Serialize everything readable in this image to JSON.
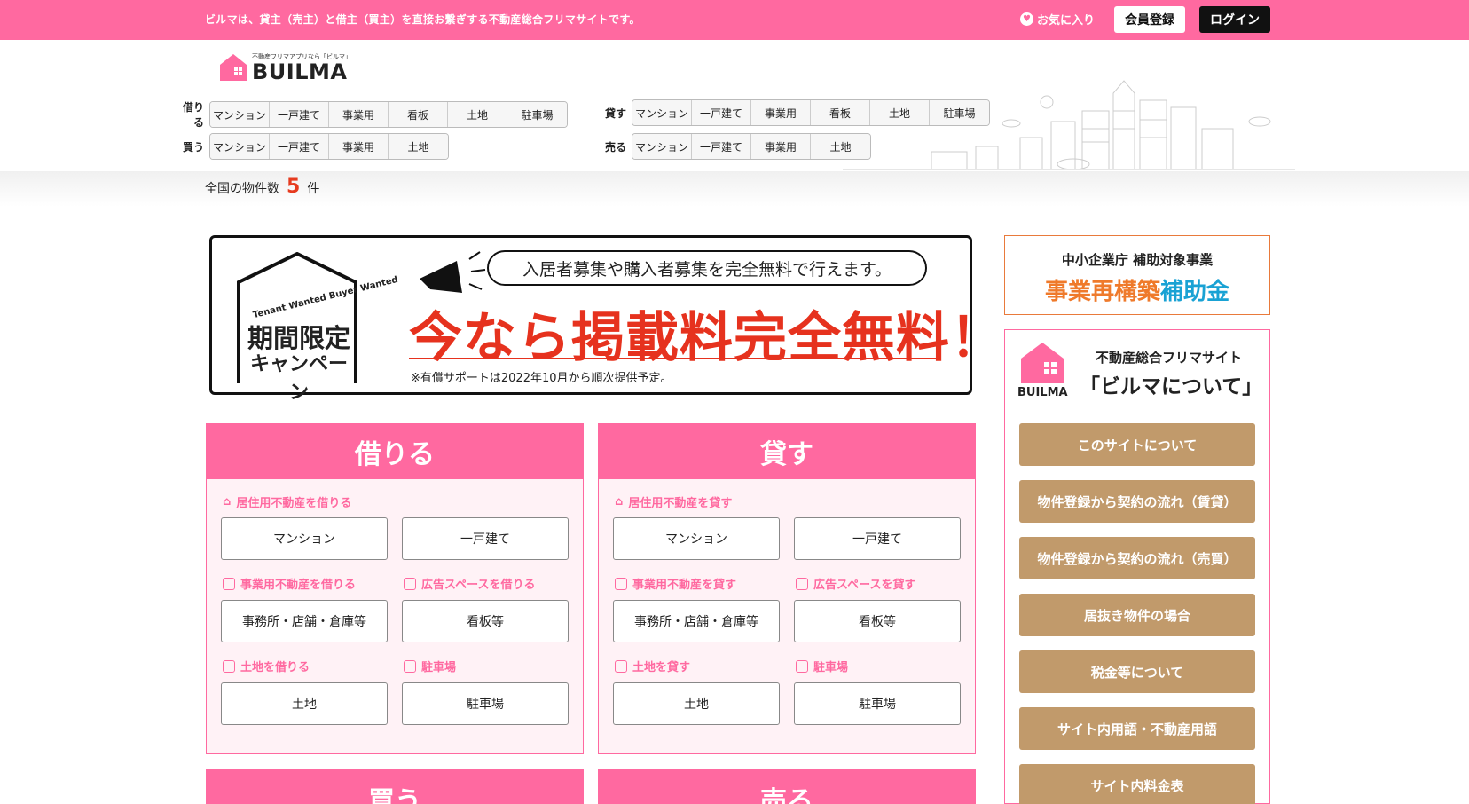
{
  "topbar": {
    "tagline": "ビルマは、貸主（売主）と借主（買主）を直接お繋ぎする不動産総合フリマサイトです。",
    "favorites": "お気に入り",
    "register": "会員登録",
    "login": "ログイン"
  },
  "logo": {
    "small": "不動産フリマアプリなら「ビルマ」",
    "big": "BUILMA"
  },
  "nav": {
    "rent": {
      "label": "借りる",
      "items": [
        "マンション",
        "一戸建て",
        "事業用",
        "看板",
        "土地",
        "駐車場"
      ]
    },
    "buy": {
      "label": "買う",
      "items": [
        "マンション",
        "一戸建て",
        "事業用",
        "土地"
      ]
    },
    "lend": {
      "label": "貸す",
      "items": [
        "マンション",
        "一戸建て",
        "事業用",
        "看板",
        "土地",
        "駐車場"
      ]
    },
    "sell": {
      "label": "売る",
      "items": [
        "マンション",
        "一戸建て",
        "事業用",
        "土地"
      ]
    }
  },
  "count": {
    "prefix": "全国の物件数",
    "value": "5",
    "suffix": "件"
  },
  "banner": {
    "tag_en": "Tenant Wanted Buyer Wanted",
    "badge_line1": "期間限定",
    "badge_line2": "キャンペーン",
    "bubble": "入居者募集や購入者募集を完全無料で行えます。",
    "headline": "今なら掲載料完全無料！",
    "note": "※有償サポートは2022年10月から順次提供予定。"
  },
  "cards": [
    {
      "title": "借りる",
      "sec1": "居住用不動産を借りる",
      "b1": "マンション",
      "b2": "一戸建て",
      "sec2": "事業用不動産を借りる",
      "sec3": "広告スペースを借りる",
      "b3": "事務所・店舗・倉庫等",
      "b4": "看板等",
      "sec4": "土地を借りる",
      "sec5": "駐車場",
      "b5": "土地",
      "b6": "駐車場"
    },
    {
      "title": "貸す",
      "sec1": "居住用不動産を貸す",
      "b1": "マンション",
      "b2": "一戸建て",
      "sec2": "事業用不動産を貸す",
      "sec3": "広告スペースを貸す",
      "b3": "事務所・店舗・倉庫等",
      "b4": "看板等",
      "sec4": "土地を貸す",
      "sec5": "駐車場",
      "b5": "土地",
      "b6": "駐車場"
    }
  ],
  "lower_cards": [
    "買う",
    "売る"
  ],
  "sidebar": {
    "subsidy_line1": "中小企業庁 補助対象事業",
    "subsidy_a": "事業",
    "subsidy_b": "再",
    "subsidy_c": "構築",
    "subsidy_d": "補助金",
    "about_sub": "不動産総合フリマサイト",
    "about_big": "「ビルマについて」",
    "about_brand": "BUILMA",
    "buttons": [
      "このサイトについて",
      "物件登録から契約の流れ（賃貸）",
      "物件登録から契約の流れ（売買）",
      "居抜き物件の場合",
      "税金等について",
      "サイト内用語・不動産用語",
      "サイト内料金表"
    ]
  },
  "colors": {
    "pink": "#ff69a0",
    "red": "#e6321e",
    "tan": "#c19a6b"
  }
}
